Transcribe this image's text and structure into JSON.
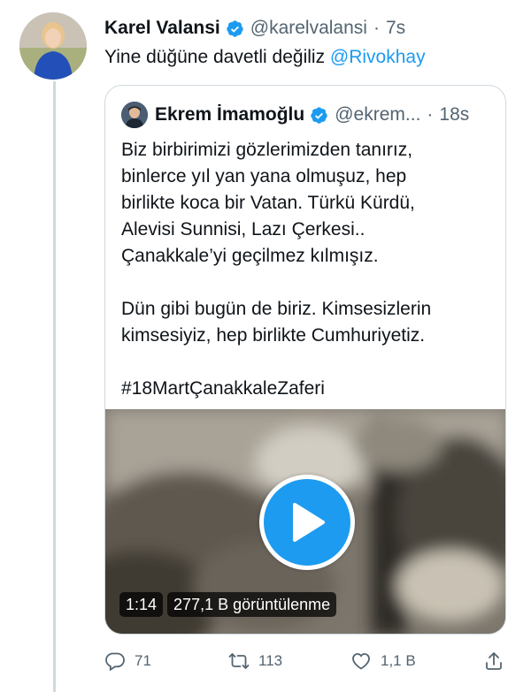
{
  "tweet": {
    "author_name": "Karel Valansi",
    "handle": "@karelvalansi",
    "separator": "·",
    "time": "7s",
    "text": "Yine düğüne davetli değiliz ",
    "mention": "@Rivokhay"
  },
  "quoted": {
    "author_name": "Ekrem İmamoğlu",
    "handle": "@ekrem...",
    "separator": "·",
    "time": "18s",
    "lines": [
      "Biz birbirimizi gözlerimizden tanırız,",
      "binlerce yıl yan yana olmuşuz, hep",
      "birlikte koca bir Vatan. Türkü Kürdü,",
      "Alevisi Sunnisi, Lazı Çerkesi..",
      "Çanakkale’yi geçilmez kılmışız."
    ],
    "lines2": [
      "Dün gibi bugün de biriz. Kimsesizlerin",
      "kimsesiyiz, hep birlikte Cumhuriyetiz."
    ],
    "hashtag": "#18MartÇanakkaleZaferi",
    "video": {
      "duration": "1:14",
      "views": "277,1 B görüntülenme"
    }
  },
  "actions": {
    "reply_count": "71",
    "retweet_count": "113",
    "like_count": "1,1 B"
  },
  "colors": {
    "accent": "#1d9bf0",
    "secondary_text": "#536471",
    "border": "#cfd9de"
  }
}
